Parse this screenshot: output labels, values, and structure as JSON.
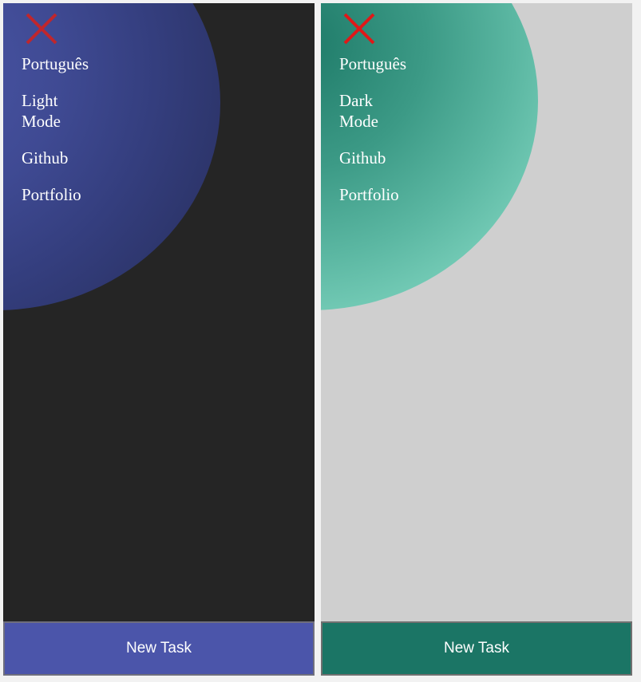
{
  "panels": [
    {
      "theme": "dark",
      "menu": [
        "Português",
        "Light Mode",
        "Github",
        "Portfolio"
      ],
      "new_task_label": "New Task",
      "colors": {
        "background": "#252525",
        "blob": "#3f4a93",
        "button": "#4b55aa",
        "close": "#c0262c"
      }
    },
    {
      "theme": "light",
      "menu": [
        "Português",
        "Dark Mode",
        "Github",
        "Portfolio"
      ],
      "new_task_label": "New Task",
      "colors": {
        "background": "#cfcfcf",
        "blob": "#4fae98",
        "button": "#1b7565",
        "close": "#e01818"
      }
    }
  ],
  "icons": {
    "close": "close-icon"
  }
}
